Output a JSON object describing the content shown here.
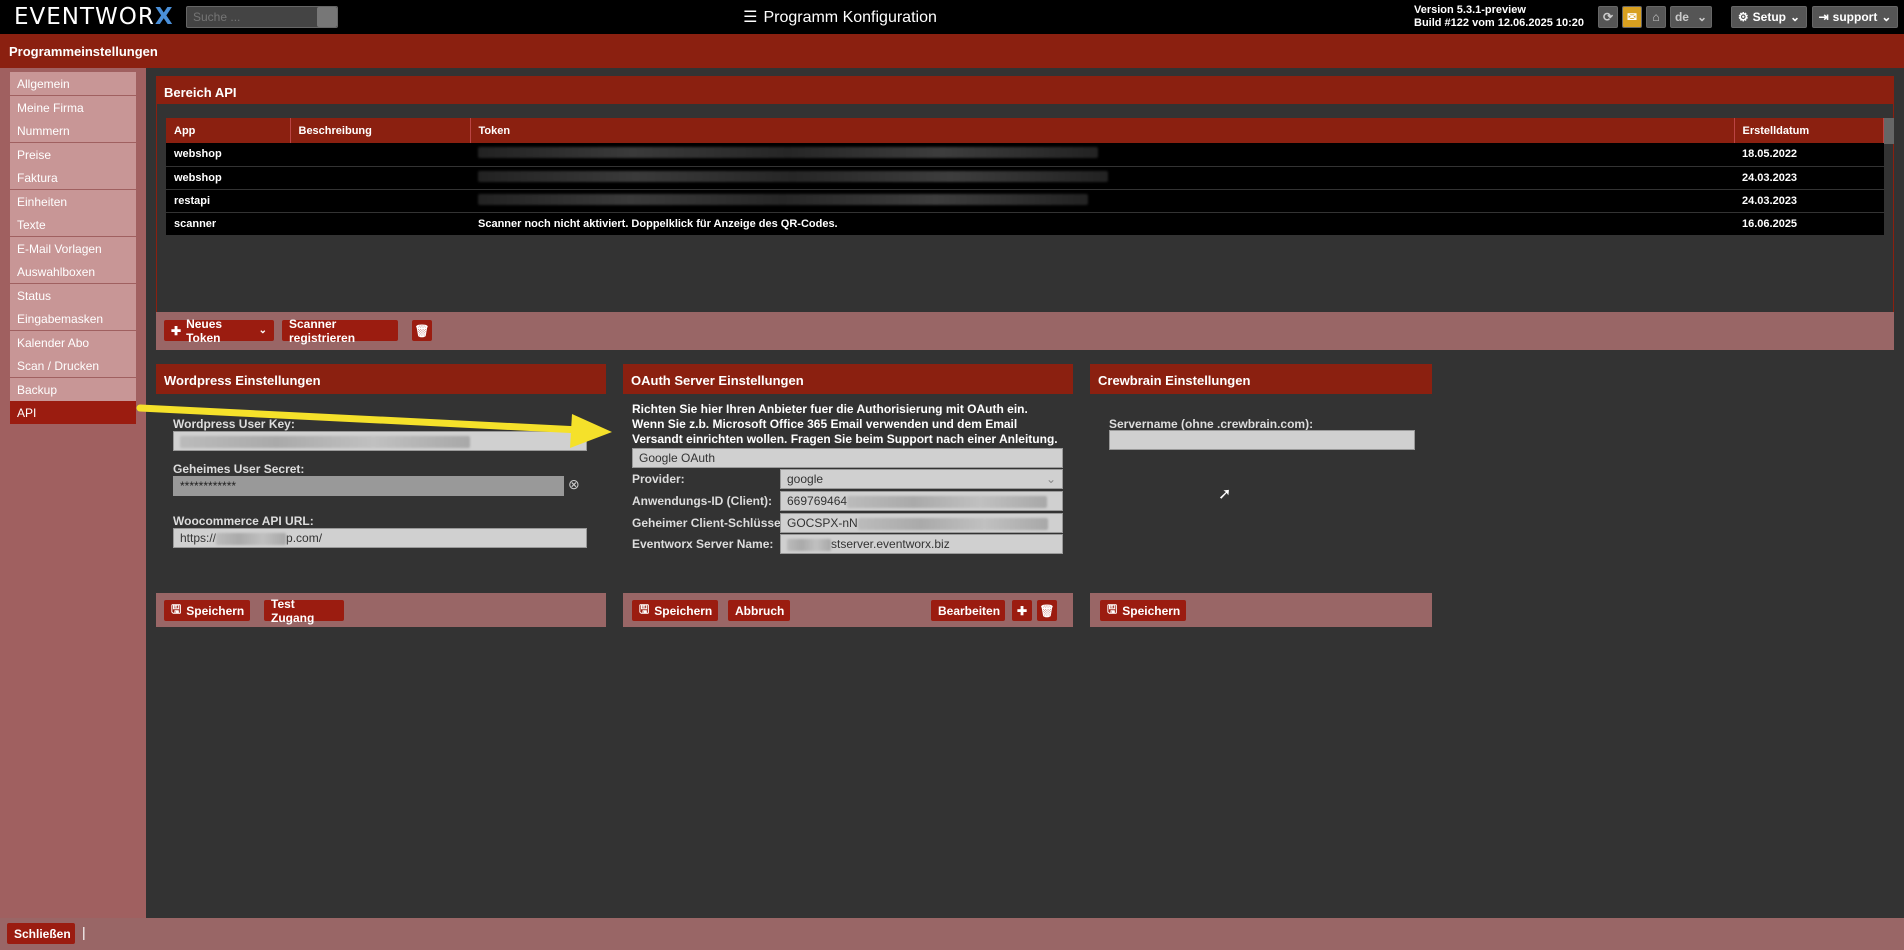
{
  "topbar": {
    "logo": "EVENTWOR",
    "logo_x": "X",
    "search_placeholder": "Suche ...",
    "title": "Programm Konfiguration",
    "version": "Version 5.3.1-preview",
    "build": "Build #122 vom 12.06.2025 10:20",
    "lang": "de",
    "setup": "Setup",
    "user": "support"
  },
  "subheader": "Programmeinstellungen",
  "sidebar": {
    "items": [
      "Allgemein",
      "Meine Firma",
      "Nummern",
      "Preise",
      "Faktura",
      "Einheiten",
      "Texte",
      "E-Mail Vorlagen",
      "Auswahlboxen",
      "Status",
      "Eingabemasken",
      "Kalender Abo",
      "Scan / Drucken",
      "Backup",
      "API"
    ],
    "active": "API"
  },
  "api": {
    "title": "Bereich API",
    "columns": [
      "App",
      "Beschreibung",
      "Token",
      "Erstelldatum"
    ],
    "rows": [
      {
        "app": "webshop",
        "desc": "",
        "token": "",
        "date": "18.05.2022"
      },
      {
        "app": "webshop",
        "desc": "",
        "token": "",
        "date": "24.03.2023"
      },
      {
        "app": "restapi",
        "desc": "",
        "token": "",
        "date": "24.03.2023"
      },
      {
        "app": "scanner",
        "desc": "",
        "token": "Scanner noch nicht aktiviert. Doppelklick für Anzeige des QR-Codes.",
        "date": "16.06.2025"
      }
    ],
    "new_token": "Neues Token",
    "register_scanner": "Scanner registrieren"
  },
  "wordpress": {
    "title": "Wordpress Einstellungen",
    "user_key_label": "Wordpress User Key:",
    "secret_label": "Geheimes User Secret:",
    "secret_value": "************",
    "api_url_label": "Woocommerce API URL:",
    "api_url_prefix": "https://",
    "api_url_suffix": "p.com/",
    "save": "Speichern",
    "test": "Test Zugang"
  },
  "oauth": {
    "title": "OAuth Server Einstellungen",
    "desc1": "Richten Sie hier Ihren Anbieter fuer die Authorisierung mit OAuth ein.",
    "desc2": "Wenn Sie z.b. Microsoft Office 365 Email verwenden und dem Email Versandt einrichten wollen. Fragen Sie beim Support nach einer Anleitung.",
    "name_value": "Google OAuth",
    "provider_label": "Provider:",
    "provider_value": "google",
    "client_label": "Anwendungs-ID (Client):",
    "client_value": "669769464",
    "secret_label": "Geheimer Client-Schlüssel:",
    "secret_value": "GOCSPX-nN",
    "server_label": "Eventworx Server Name:",
    "server_value": "stserver.eventworx.biz",
    "save": "Speichern",
    "cancel": "Abbruch",
    "edit": "Bearbeiten"
  },
  "crewbrain": {
    "title": "Crewbrain Einstellungen",
    "server_label": "Servername (ohne .crewbrain.com):",
    "save": "Speichern"
  },
  "footer": {
    "close": "Schließen"
  },
  "colors": {
    "accent": "#8b2010",
    "sidebar": "#a06060",
    "arrow": "#f5e12a"
  }
}
